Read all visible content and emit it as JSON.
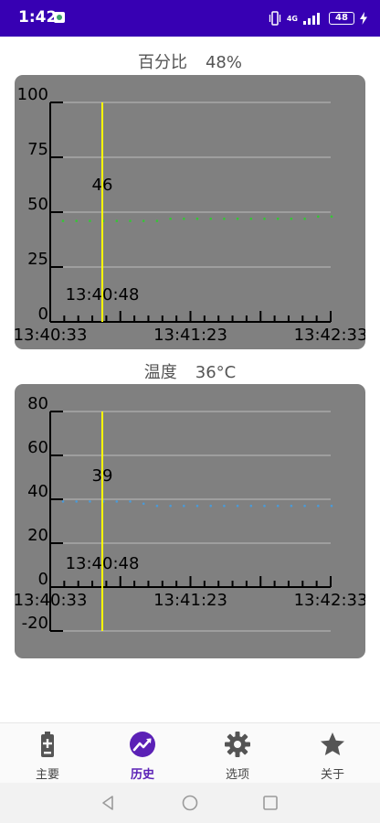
{
  "status_bar": {
    "time": "1:42",
    "network": "4G",
    "battery": "48",
    "icons": [
      "notification-icon",
      "vibrate-icon",
      "signal-icon",
      "battery-icon",
      "charging-icon"
    ]
  },
  "percent_section": {
    "label": "百分比",
    "value": "48%"
  },
  "temperature_section": {
    "label": "温度",
    "value": "36°C"
  },
  "chart_data": [
    {
      "type": "line",
      "yticks": [
        0,
        25,
        50,
        75,
        100
      ],
      "ylim": [
        0,
        100
      ],
      "xticks": [
        "13:40:33",
        "13:41:23",
        "13:42:33"
      ],
      "grid": true,
      "series": [
        {
          "values": [
            46,
            46,
            46,
            46,
            46,
            46,
            46,
            46,
            47,
            47,
            47,
            47,
            47,
            47,
            47,
            47,
            47,
            47,
            47,
            48,
            48
          ]
        }
      ],
      "cursor": {
        "time": "13:40:48",
        "value": "46"
      },
      "colors": {
        "background": "#808080",
        "series": "#34c734",
        "cursor": "#ffff00",
        "grid": "#a8a8a8",
        "axis": "#000000"
      }
    },
    {
      "type": "line",
      "yticks": [
        -20,
        0,
        20,
        40,
        60,
        80
      ],
      "ylim": [
        -20,
        80
      ],
      "xticks": [
        "13:40:33",
        "13:41:23",
        "13:42:33"
      ],
      "grid": true,
      "series": [
        {
          "values": [
            39,
            39,
            39,
            39,
            39,
            39,
            38,
            37,
            37,
            37,
            37,
            37,
            37,
            37,
            37,
            37,
            37,
            37,
            37,
            37,
            37
          ]
        }
      ],
      "cursor": {
        "time": "13:40:48",
        "value": "39"
      },
      "colors": {
        "background": "#808080",
        "series": "#4a9ad8",
        "cursor": "#ffff00",
        "grid": "#a8a8a8",
        "axis": "#000000"
      }
    }
  ],
  "nav": {
    "items": [
      {
        "label": "主要",
        "icon": "battery-icon",
        "active": false
      },
      {
        "label": "历史",
        "icon": "trend-chart-icon",
        "active": true
      },
      {
        "label": "选项",
        "icon": "gear-icon",
        "active": false
      },
      {
        "label": "关于",
        "icon": "star-icon",
        "active": false
      }
    ],
    "colors": {
      "active": "#5b21b6",
      "inactive": "#555555"
    }
  },
  "system_nav": {
    "icons": [
      "back-icon",
      "home-icon",
      "recents-icon"
    ]
  }
}
